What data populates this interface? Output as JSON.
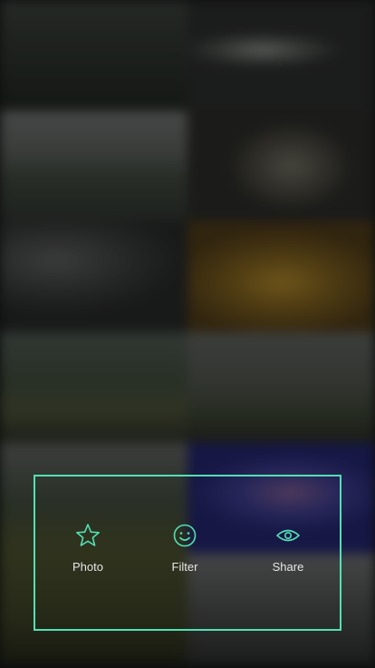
{
  "background": {
    "description_tiles": 12
  },
  "panel": {
    "accent_color": "#52e0b4",
    "actions": [
      {
        "label": "Photo",
        "icon": "star-icon"
      },
      {
        "label": "Filter",
        "icon": "smiley-icon"
      },
      {
        "label": "Share",
        "icon": "eye-icon"
      }
    ]
  }
}
